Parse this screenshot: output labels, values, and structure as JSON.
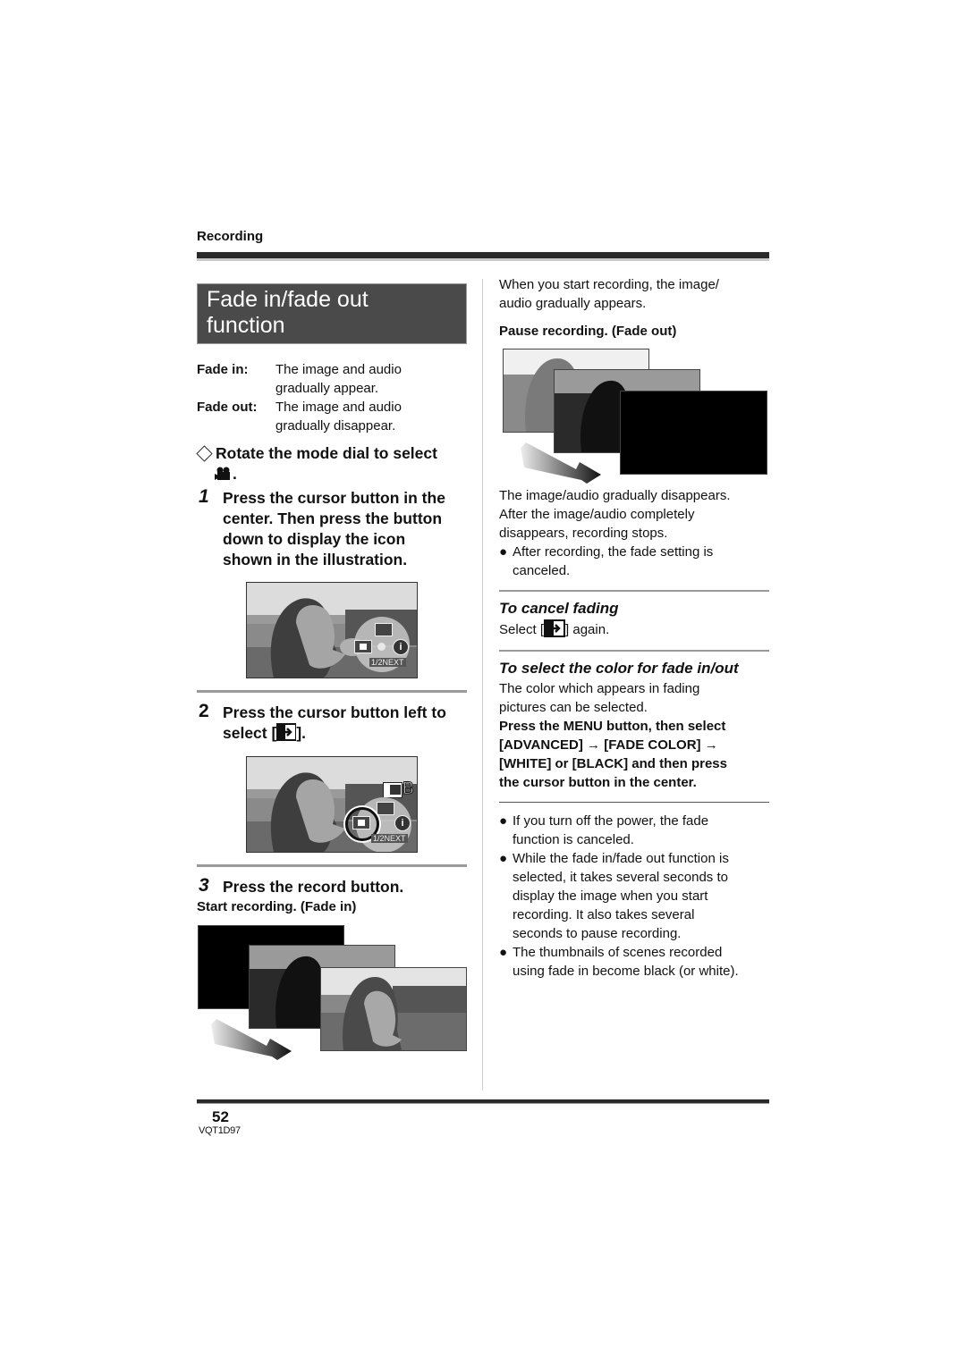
{
  "header": {
    "section": "Recording"
  },
  "title": {
    "line1": "Fade in/fade out",
    "line2": "function"
  },
  "definitions": [
    {
      "term": "Fade in:",
      "desc_line1": "The image and audio",
      "desc_line2": "gradually appear."
    },
    {
      "term": "Fade out:",
      "desc_line1": "The image and audio",
      "desc_line2": "gradually disappear."
    }
  ],
  "prestep": {
    "text": "Rotate the mode dial to select",
    "suffix": ".",
    "icon": "movie-camera-icon"
  },
  "steps": [
    {
      "number": "1",
      "lines": [
        "Press the cursor button in the",
        "center. Then press the button",
        "down to display the icon",
        "shown in the illustration."
      ]
    },
    {
      "number": "2",
      "line1": "Press the cursor button left to",
      "line2_prefix": "select [",
      "line2_suffix": "].",
      "icon": "fade-icon"
    },
    {
      "number": "3",
      "text": "Press the record button.",
      "caption": "Start recording. (Fade in)"
    }
  ],
  "screens": {
    "step1": {
      "overlay_label": "1/2NEXT",
      "icons": [
        "fade-icon",
        "backlight-icon",
        "info-icon"
      ]
    },
    "step2": {
      "overlay_label": "1/2NEXT",
      "indicator": "B",
      "icons": [
        "fade-icon",
        "backlight-icon",
        "info-icon"
      ]
    }
  },
  "right_column": {
    "intro": [
      "When you start recording, the image/",
      "audio gradually appears."
    ],
    "pause_caption": "Pause recording. (Fade out)",
    "disappear_text": [
      "The image/audio gradually disappears.",
      "After the image/audio completely",
      "disappears, recording stops."
    ],
    "bullet_after": [
      "After recording, the fade setting is",
      "canceled."
    ],
    "cancel": {
      "heading": "To cancel fading",
      "prefix": "Select [",
      "suffix": "] again."
    },
    "color": {
      "heading": "To select the color for fade in/out",
      "desc": [
        "The color which appears in fading",
        "pictures can be selected."
      ],
      "instructions": [
        "Press the MENU button, then select",
        "[ADVANCED] → [FADE COLOR] →",
        "[WHITE] or [BLACK] and then press",
        "the cursor button in the center."
      ]
    },
    "notes": [
      [
        "If you turn off the power, the fade",
        "function is canceled."
      ],
      [
        "While the fade in/fade out function is",
        "selected, it takes several seconds to",
        "display the image when you start",
        "recording. It also takes several",
        "seconds to pause recording."
      ],
      [
        "The thumbnails of scenes recorded",
        "using fade in become black (or white)."
      ]
    ],
    "bullet_glyph": "●"
  },
  "footer": {
    "page_number": "52",
    "doc_code": "VQT1D97"
  }
}
